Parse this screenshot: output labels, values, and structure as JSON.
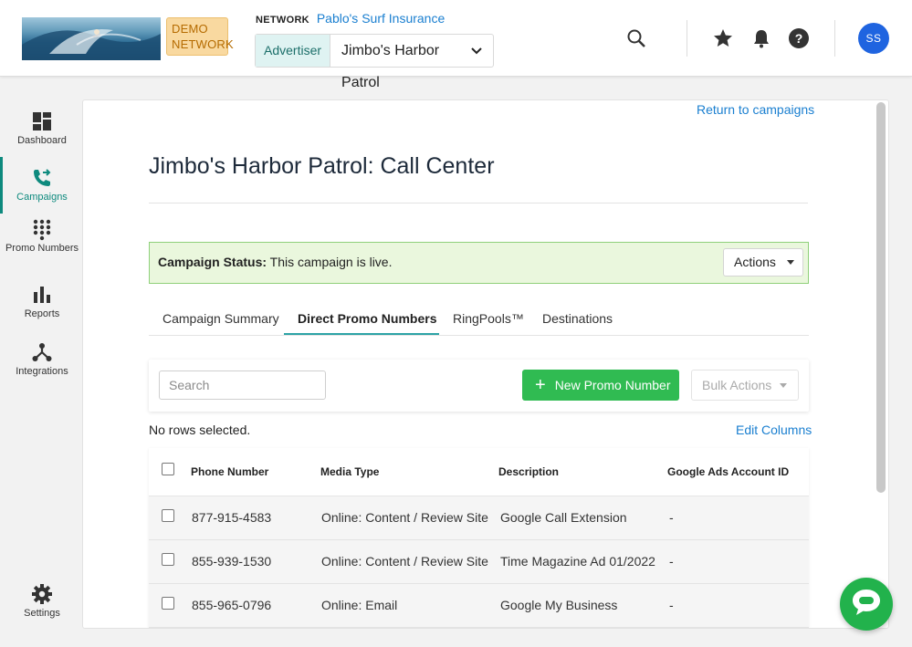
{
  "header": {
    "demo_badge": "DEMO NETWORK",
    "network_label": "NETWORK",
    "network_name": "Pablo's Surf Insurance",
    "advertiser_label": "Advertiser",
    "advertiser_value": "Jimbo's Harbor Patrol",
    "user_initials": "SS",
    "icons": [
      "search-icon",
      "star-icon",
      "bell-icon",
      "help-icon"
    ]
  },
  "sidebar": {
    "items": [
      {
        "label": "Dashboard",
        "icon": "dashboard-icon"
      },
      {
        "label": "Campaigns",
        "icon": "campaigns-icon",
        "active": true
      },
      {
        "label": "Promo Numbers",
        "icon": "dial-pad-icon"
      },
      {
        "label": "Reports",
        "icon": "bar-chart-icon"
      },
      {
        "label": "Integrations",
        "icon": "integrations-icon"
      },
      {
        "label": "Settings",
        "icon": "gear-icon"
      }
    ]
  },
  "main": {
    "return_link": "Return to campaigns",
    "title": "Jimbo's Harbor Patrol: Call Center",
    "status_label": "Campaign Status:",
    "status_text": "This campaign is live.",
    "actions_label": "Actions",
    "tabs": [
      {
        "label": "Campaign Summary"
      },
      {
        "label": "Direct Promo Numbers",
        "active": true
      },
      {
        "label": "RingPools™"
      },
      {
        "label": "Destinations"
      }
    ],
    "search_placeholder": "Search",
    "new_button": "New Promo Number",
    "bulk_actions": "Bulk Actions",
    "rows_selected": "No rows selected.",
    "edit_columns": "Edit Columns",
    "table": {
      "columns": [
        "Phone Number",
        "Media Type",
        "Description",
        "Google Ads Account ID"
      ],
      "rows": [
        {
          "phone": "877-915-4583",
          "media": "Online: Content / Review Site",
          "description": "Google Call Extension",
          "ads_id": "-"
        },
        {
          "phone": "855-939-1530",
          "media": "Online: Content / Review Site",
          "description": "Time Magazine Ad 01/2022",
          "ads_id": "-"
        },
        {
          "phone": "855-965-0796",
          "media": "Online: Email",
          "description": "Google My Business",
          "ads_id": "-"
        }
      ]
    }
  },
  "colors": {
    "accent_teal": "#0e8a7e",
    "link_blue": "#1a7fd0",
    "primary_green": "#30bb52",
    "status_green_bg": "#eaf7dd",
    "avatar_blue": "#1f64e0"
  }
}
